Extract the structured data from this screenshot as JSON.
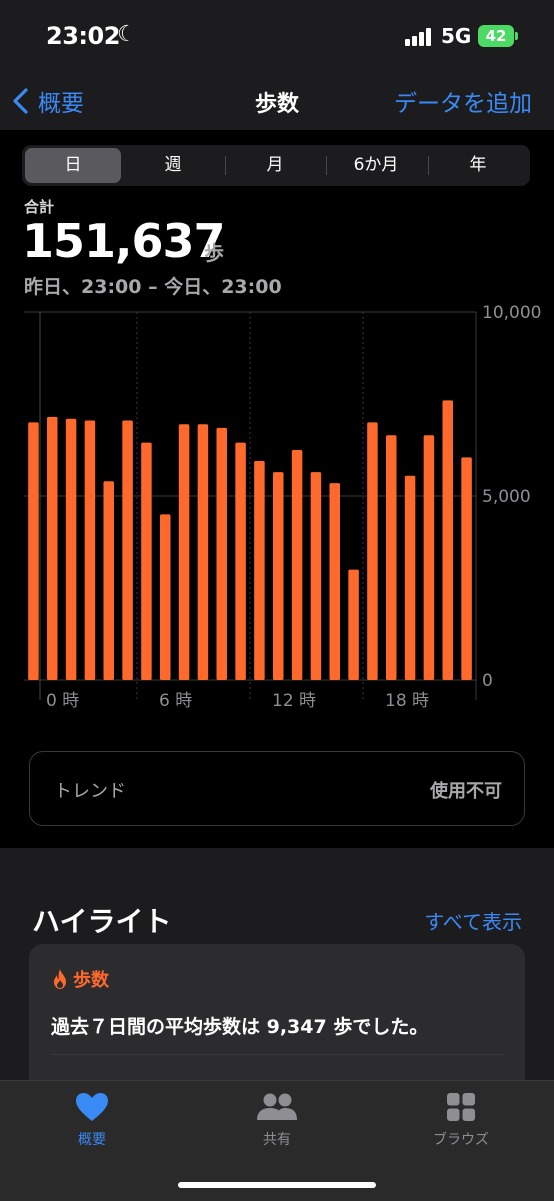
{
  "status_bar": {
    "time": "23:02",
    "network": "5G",
    "battery": "42"
  },
  "nav": {
    "back_label": "概要",
    "title": "歩数",
    "action_label": "データを追加"
  },
  "segments": {
    "items": [
      "日",
      "週",
      "月",
      "6か月",
      "年"
    ],
    "selected": "日"
  },
  "summary": {
    "label": "合計",
    "total": "151,637",
    "unit": "歩",
    "range": "昨日、23:00 – 今日、23:00"
  },
  "chart_data": {
    "type": "bar",
    "title": "",
    "xlabel": "",
    "ylabel": "",
    "ylim": [
      0,
      10000
    ],
    "y_ticks": [
      "10,000",
      "5,000",
      "0"
    ],
    "x_tick_labels": [
      "0 時",
      "6 時",
      "12 時",
      "18 時"
    ],
    "values": [
      7000,
      7150,
      7100,
      7050,
      5400,
      7050,
      6450,
      4500,
      6950,
      6950,
      6850,
      6450,
      5950,
      5650,
      6250,
      5650,
      5350,
      3000,
      7000,
      6650,
      5550,
      6650,
      7600,
      6050
    ],
    "bar_color": "#ff6a2c",
    "grid": true
  },
  "trend": {
    "label": "トレンド",
    "value": "使用不可"
  },
  "highlights": {
    "title": "ハイライト",
    "more_label": "すべて表示",
    "card": {
      "category": "歩数",
      "text": "過去７日間の平均歩数は 9,347 歩でした。"
    }
  },
  "tabbar": {
    "items": [
      {
        "label": "概要",
        "icon": "heart-icon",
        "active": true
      },
      {
        "label": "共有",
        "icon": "people-icon",
        "active": false
      },
      {
        "label": "ブラウズ",
        "icon": "grid-icon",
        "active": false
      }
    ],
    "active_color": "#3a8af5"
  }
}
